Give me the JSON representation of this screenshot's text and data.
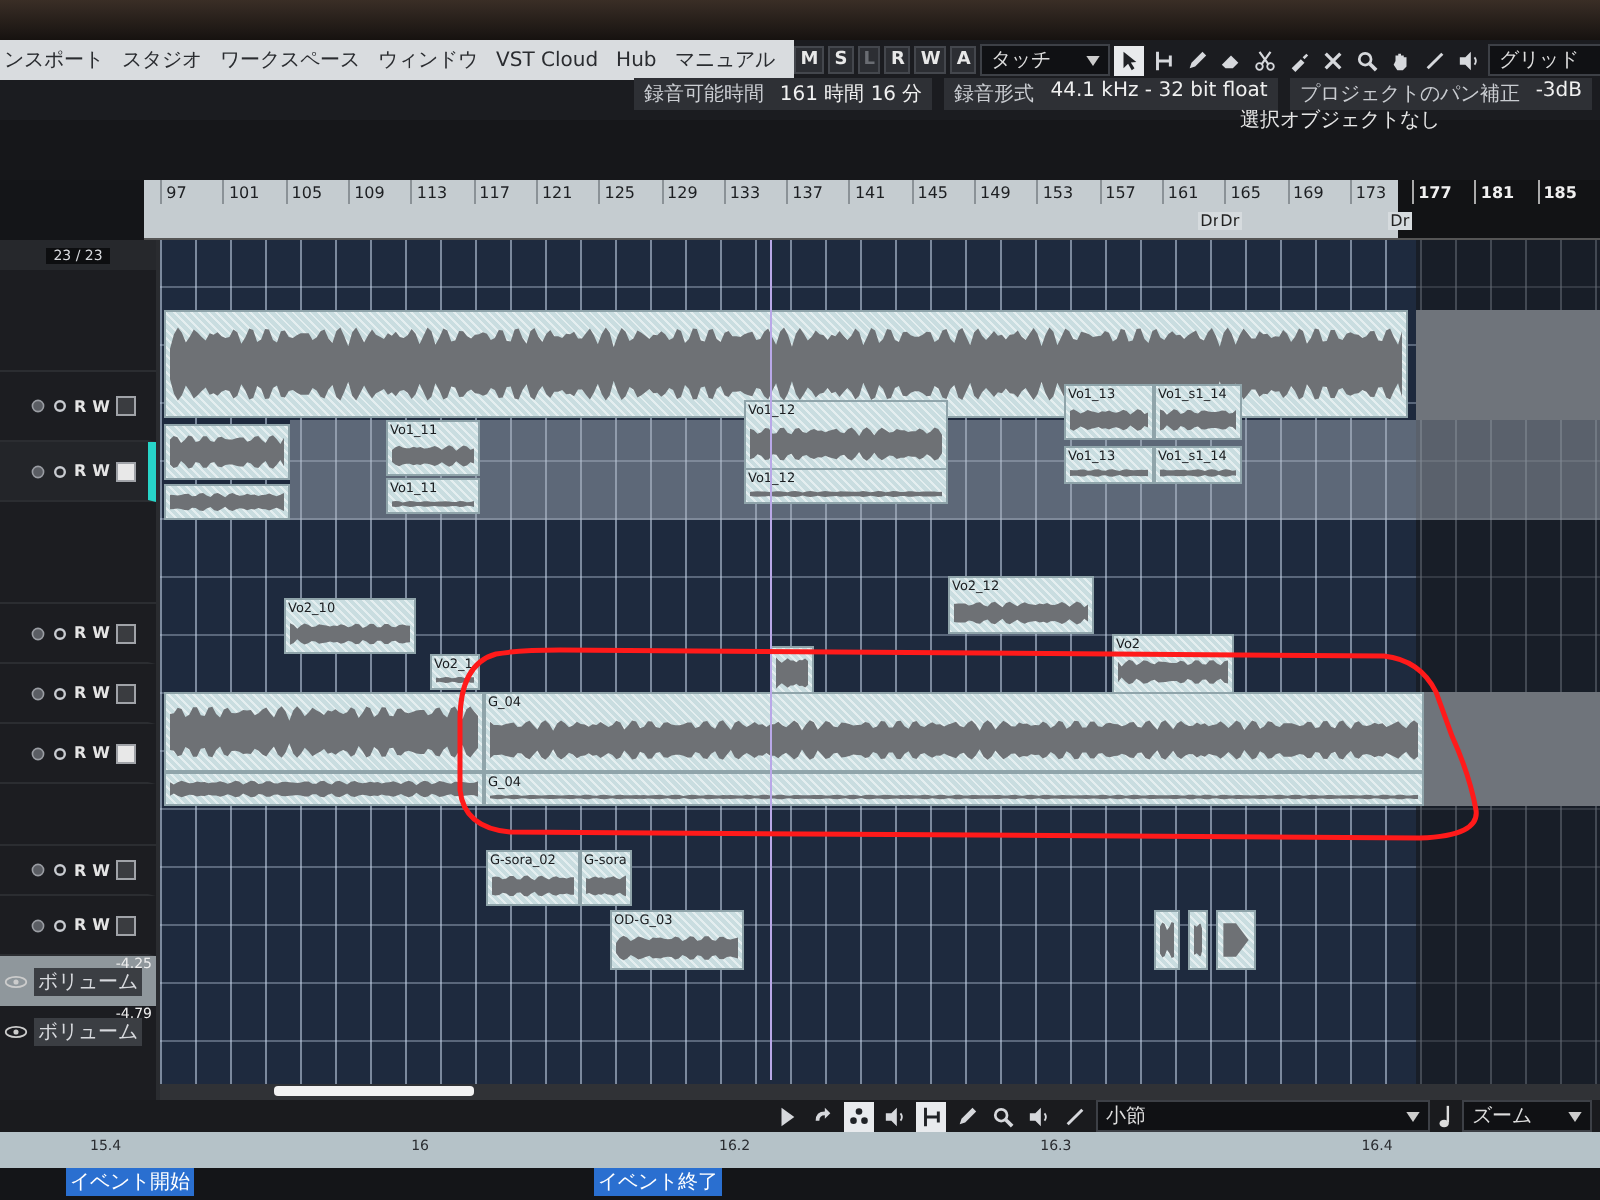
{
  "menu": [
    "ンスポート",
    "スタジオ",
    "ワークスペース",
    "ウィンドウ",
    "VST Cloud",
    "Hub",
    "マニュアル"
  ],
  "mode_buttons": [
    {
      "label": "M",
      "disabled": false
    },
    {
      "label": "S",
      "disabled": false
    },
    {
      "label": "L",
      "disabled": true
    },
    {
      "label": "R",
      "disabled": false
    },
    {
      "label": "W",
      "disabled": false
    },
    {
      "label": "A",
      "disabled": false
    }
  ],
  "automation_mode": {
    "value": "タッチ"
  },
  "tools": [
    {
      "kind": "pointer",
      "selected": true
    },
    {
      "kind": "range",
      "selected": false
    },
    {
      "kind": "pencil",
      "selected": false
    },
    {
      "kind": "eraser",
      "selected": false
    },
    {
      "kind": "split",
      "selected": false
    },
    {
      "kind": "glue",
      "selected": false
    },
    {
      "kind": "mute",
      "selected": false
    },
    {
      "kind": "zoom",
      "selected": false
    },
    {
      "kind": "hand",
      "selected": false
    },
    {
      "kind": "line",
      "selected": false
    },
    {
      "kind": "speaker",
      "selected": false
    }
  ],
  "grid": {
    "value": "グリッド"
  },
  "info": [
    {
      "label": "録音可能時間",
      "value": "161 時間 16 分"
    },
    {
      "label": "録音形式",
      "value": "44.1 kHz - 32 bit float"
    },
    {
      "label": "プロジェクトのパン補正",
      "value": "-3dB"
    }
  ],
  "selection_status": "選択オブジェクトなし",
  "track_counter": "23 / 23",
  "ruler": {
    "bars": [
      "97",
      "101",
      "105",
      "109",
      "113",
      "117",
      "121",
      "125",
      "129",
      "133",
      "137",
      "141",
      "145",
      "149",
      "153",
      "157",
      "161",
      "165",
      "169",
      "173",
      "177",
      "181",
      "185"
    ],
    "markers": [
      "Dr",
      "Dr",
      "Dr"
    ]
  },
  "tracks": [
    {
      "read": "R",
      "write": "W",
      "selected": false,
      "edit_active": false
    },
    {
      "read": "R",
      "write": "W",
      "selected": true,
      "edit_active": true
    },
    {
      "read": "R",
      "write": "W",
      "selected": false,
      "edit_active": false
    },
    {
      "read": "R",
      "write": "W",
      "selected": false,
      "edit_active": false
    },
    {
      "read": "R",
      "write": "W",
      "selected": false,
      "edit_active": true
    },
    {
      "read": "R",
      "write": "W",
      "selected": false,
      "edit_active": false
    },
    {
      "read": "R",
      "write": "W",
      "selected": false,
      "edit_active": false
    }
  ],
  "clips": [
    {
      "kind": "audio"
    },
    {
      "kind": "audio"
    },
    {
      "kind": "audio"
    },
    {
      "kind": "audio",
      "label": "Vo1_11"
    },
    {
      "kind": "audio",
      "label": "Vo1_11"
    },
    {
      "kind": "audio",
      "label": "Vo1_12"
    },
    {
      "kind": "audio",
      "label": "Vo1_12"
    },
    {
      "kind": "audio",
      "label": "Vo1_13"
    },
    {
      "kind": "audio",
      "label": "Vo1_s1_14"
    },
    {
      "kind": "audio",
      "label": "Vo1_13"
    },
    {
      "kind": "audio",
      "label": "Vo1_s1_14"
    },
    {
      "kind": "audio",
      "label": "Vo2_10"
    },
    {
      "kind": "audio",
      "label": "Vo2_1"
    },
    {
      "kind": "audio",
      "label": "Vo2_12"
    },
    {
      "kind": "audio"
    },
    {
      "kind": "audio",
      "label": "Vo2"
    },
    {
      "kind": "audio"
    },
    {
      "kind": "audio",
      "label": "G_04"
    },
    {
      "kind": "audio"
    },
    {
      "kind": "audio",
      "label": "G_04"
    },
    {
      "kind": "audio",
      "label": "G-sora_02"
    },
    {
      "kind": "audio",
      "label": "G-sora"
    },
    {
      "kind": "audio",
      "label": "OD-G_03"
    },
    {
      "kind": "audio"
    },
    {
      "kind": "audio"
    },
    {
      "kind": "fade"
    }
  ],
  "volume_rows": [
    {
      "value": "-4.25",
      "parameter": "ボリューム",
      "selected": true
    },
    {
      "value": "-4.79",
      "parameter": "ボリューム",
      "selected": false
    }
  ],
  "bottom_tools": [
    {
      "kind": "play",
      "selected": false
    },
    {
      "kind": "cycle",
      "selected": false
    },
    {
      "kind": "object",
      "selected": true
    },
    {
      "kind": "speaker",
      "selected": false
    },
    {
      "kind": "range",
      "selected": true
    },
    {
      "kind": "pencil",
      "selected": false
    },
    {
      "kind": "zoom",
      "selected": false
    },
    {
      "kind": "speaker",
      "selected": false
    },
    {
      "kind": "line",
      "selected": false
    }
  ],
  "quantize": {
    "value": "小節"
  },
  "zoom": {
    "value": "ズーム"
  },
  "lower_ruler": [
    "15.4",
    "16",
    "16.2",
    "16.3",
    "16.4"
  ],
  "event_markers": [
    "イベント開始",
    "イベント終了"
  ]
}
